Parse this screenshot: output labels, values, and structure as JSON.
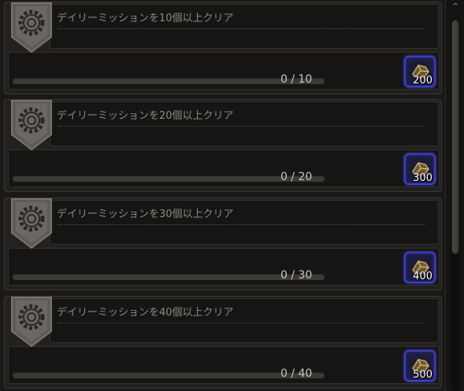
{
  "missions": [
    {
      "title": "デイリーミッションを10個以上クリア",
      "current": 0,
      "target": 10,
      "progress_text": "0 / 10",
      "reward_amount": "200",
      "reward_icon": "gold-item-icon"
    },
    {
      "title": "デイリーミッションを20個以上クリア",
      "current": 0,
      "target": 20,
      "progress_text": "0 / 20",
      "reward_amount": "300",
      "reward_icon": "gold-item-icon"
    },
    {
      "title": "デイリーミッションを30個以上クリア",
      "current": 0,
      "target": 30,
      "progress_text": "0 / 30",
      "reward_amount": "400",
      "reward_icon": "gold-item-icon"
    },
    {
      "title": "デイリーミッションを40個以上クリア",
      "current": 0,
      "target": 40,
      "progress_text": "0 / 40",
      "reward_amount": "500",
      "reward_icon": "gold-item-icon"
    }
  ],
  "badge_icon": "gear-emblem-icon",
  "scrollbar": {
    "up_icon": "chevron-up-icon"
  },
  "colors": {
    "reward_border": "#3d3ec4",
    "progress_fill": "#c9a24a",
    "title_text": "#8b8782"
  }
}
